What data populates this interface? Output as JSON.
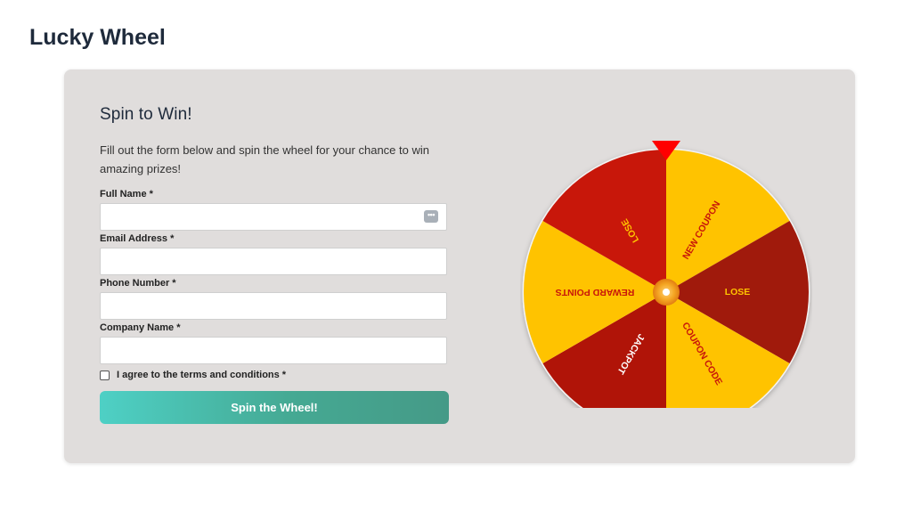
{
  "page": {
    "title": "Lucky Wheel"
  },
  "form": {
    "heading": "Spin to Win!",
    "description": "Fill out the form below and spin the wheel for your chance to win amazing prizes!",
    "fields": [
      {
        "label": "Full Name *",
        "value": "",
        "placeholder": ""
      },
      {
        "label": "Email Address *",
        "value": "",
        "placeholder": ""
      },
      {
        "label": "Phone Number *",
        "value": "",
        "placeholder": ""
      },
      {
        "label": "Company Name *",
        "value": "",
        "placeholder": ""
      }
    ],
    "agree_label": "I agree to the terms and conditions *",
    "agree_checked": false,
    "submit_label": "Spin the Wheel!",
    "autofill_icon": "more-dots-icon"
  },
  "wheel": {
    "pointer_color": "#ff0000",
    "hub_color": "#f5a623",
    "segments": [
      {
        "label": "NEW COUPON",
        "fill": "#ffc300",
        "text_color": "#c8170a"
      },
      {
        "label": "LOSE",
        "fill": "#a01a0c",
        "text_color": "#ffc300"
      },
      {
        "label": "COUPON CODE",
        "fill": "#ffc300",
        "text_color": "#c8170a"
      },
      {
        "label": "JACKPOT",
        "fill": "#b01408",
        "text_color": "#ffffff"
      },
      {
        "label": "REWARD POINTS",
        "fill": "#ffc300",
        "text_color": "#c8170a"
      },
      {
        "label": "LOSE",
        "fill": "#c8170a",
        "text_color": "#ffc300"
      }
    ]
  },
  "colors": {
    "card_bg": "#e0dddc",
    "button_gradient_start": "#4ed0c5",
    "button_gradient_end": "#459a87"
  }
}
